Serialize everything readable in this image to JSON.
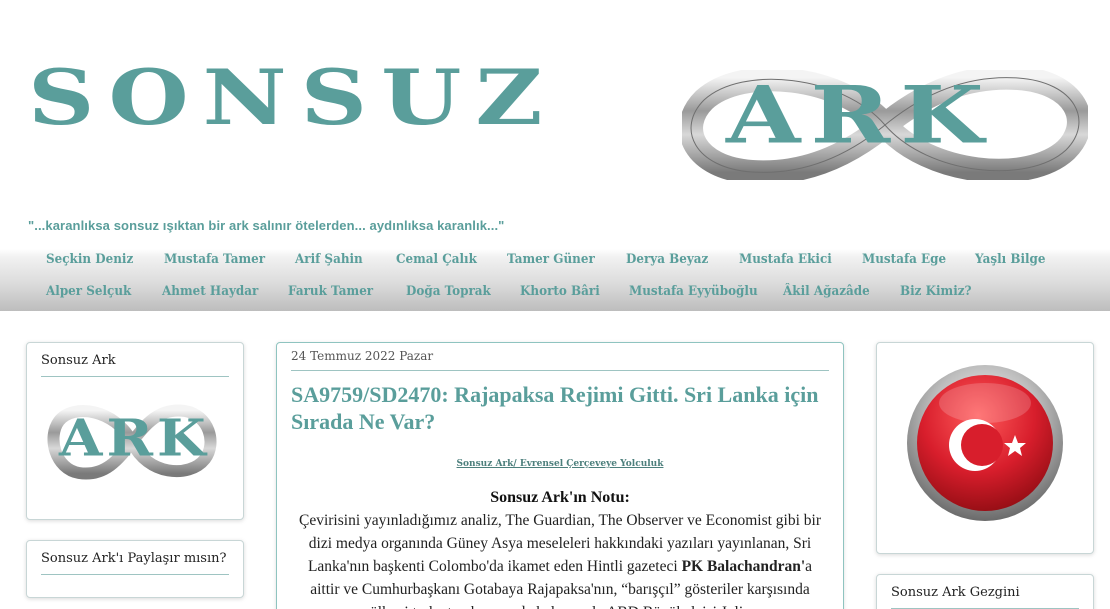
{
  "header": {
    "logo_left": "SONSUZ",
    "logo_right": "ARK",
    "tagline": "\"...karanlıksa sonsuz ışıktan bir ark salınır ötelerden... aydınlıksa karanlık...\""
  },
  "nav": {
    "row1": [
      "Seçkin Deniz",
      "Mustafa Tamer",
      "Arif Şahin",
      "Cemal Çalık",
      "Tamer Güner",
      "Derya Beyaz",
      "Mustafa Ekici",
      "Mustafa Ege",
      "Yaşlı Bilge"
    ],
    "row2": [
      "Alper Selçuk",
      "Ahmet Haydar",
      "Faruk Tamer",
      "Doğa Toprak",
      "Khorto Bâri",
      "Mustafa Eyyüboğlu",
      "Âkil Ağazâde",
      "Biz Kimiz?"
    ]
  },
  "left": {
    "widget1_title": "Sonsuz Ark",
    "widget1_logo": "ARK",
    "widget2_title": "Sonsuz Ark'ı Paylaşır mısın?"
  },
  "post": {
    "date": "24 Temmuz 2022 Pazar",
    "title": "SA9759/SD2470: Rajapaksa Rejimi Gitti. Sri Lanka için Sırada Ne Var?",
    "source_link": "Sonsuz Ark/ Evrensel Çerçeveye Yolculuk",
    "note_title": "Sonsuz Ark'ın Notu:",
    "body_1": "Çevirisini yayınladığımız analiz, The Guardian, The Observer ve Economist gibi bir dizi medya organında Güney Asya meseleleri hakkındaki yazıları yayınlanan, Sri Lanka'nın başkenti Colombo'da ikamet eden Hintli gazeteci ",
    "body_bold": "PK Balachandran'",
    "body_2": "a aittir ve Cumhurbaşkanı Gotabaya Rajapaksa'nın, “barışçıl” gösteriler karşısında ülkeyi terk etmek zorunda kalmasıyla ABD Büyükelçisi Julie"
  },
  "right": {
    "widget2_title": "Sonsuz Ark Gezgini"
  },
  "colors": {
    "accent": "#5a9e9b",
    "flag_red": "#d81e2c"
  }
}
